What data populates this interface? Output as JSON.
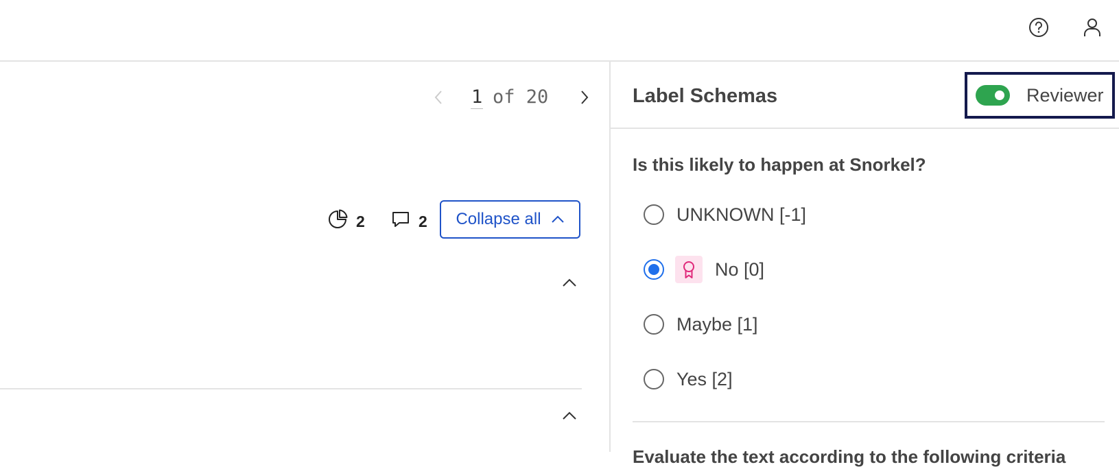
{
  "header": {
    "help_icon": "help-circle-icon",
    "user_icon": "user-icon"
  },
  "pager": {
    "current": "1",
    "of_text": "of 20"
  },
  "toolbar": {
    "progress_count": "2",
    "comments_count": "2",
    "collapse_all_label": "Collapse all"
  },
  "panel": {
    "title": "Label Schemas",
    "reviewer_label": "Reviewer",
    "reviewer_enabled": true,
    "toggle_color": "#2ea44f",
    "question": "Is this likely to happen at Snorkel?",
    "options": [
      {
        "label": "UNKNOWN [-1]",
        "selected": false
      },
      {
        "label": "No [0]",
        "selected": true,
        "badge": "award-ribbon-icon"
      },
      {
        "label": "Maybe [1]",
        "selected": false
      },
      {
        "label": "Yes [2]",
        "selected": false
      }
    ],
    "next_question": "Evaluate the text according to the following criteria"
  },
  "colors": {
    "accent": "#1f53c8",
    "radio_selected": "#1f6feb",
    "badge_bg": "#fde2ee",
    "badge_icon": "#e0287a",
    "reviewer_border": "#141a4d"
  }
}
